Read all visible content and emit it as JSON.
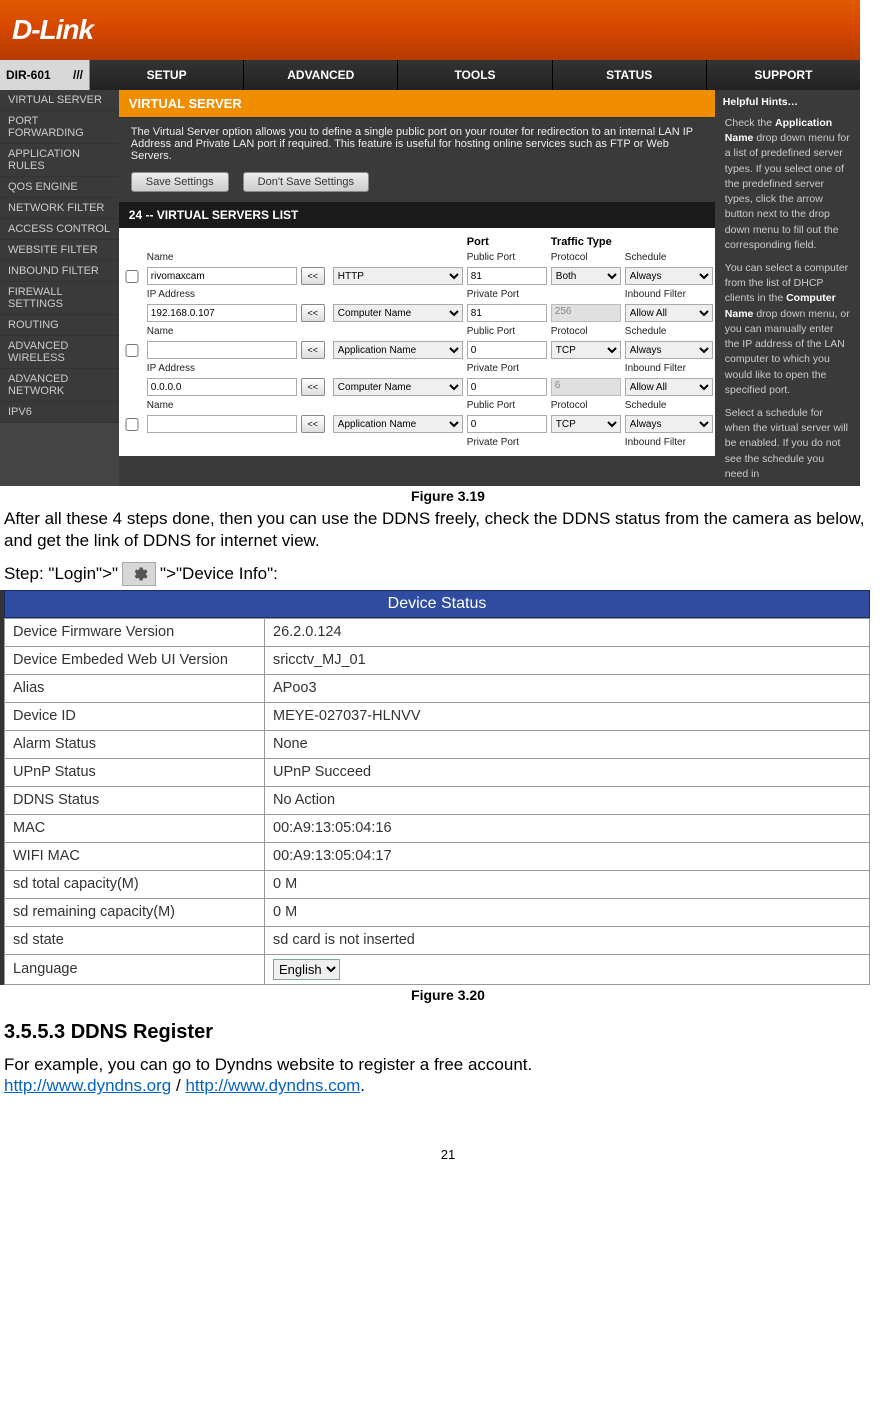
{
  "router": {
    "logo_text": "D-Link",
    "model": "DIR-601",
    "model_bars": "///",
    "tabs": [
      "SETUP",
      "ADVANCED",
      "TOOLS",
      "STATUS",
      "SUPPORT"
    ],
    "sidebar": [
      "VIRTUAL SERVER",
      "PORT FORWARDING",
      "APPLICATION RULES",
      "QOS ENGINE",
      "NETWORK FILTER",
      "ACCESS CONTROL",
      "WEBSITE FILTER",
      "INBOUND FILTER",
      "FIREWALL SETTINGS",
      "ROUTING",
      "ADVANCED WIRELESS",
      "ADVANCED NETWORK",
      "IPV6"
    ],
    "vs_title": "VIRTUAL SERVER",
    "vs_desc": "The Virtual Server option allows you to define a single public port on your router for redirection to an internal LAN IP Address and Private LAN port if required. This feature is useful for hosting online services such as FTP or Web Servers.",
    "btn_save": "Save Settings",
    "btn_dont": "Don't Save Settings",
    "vs_list_title": "24 -- VIRTUAL SERVERS LIST",
    "col_port": "Port",
    "col_traffic": "Traffic Type",
    "lbl_name": "Name",
    "lbl_ip": "IP Address",
    "lbl_public": "Public Port",
    "lbl_private": "Private Port",
    "lbl_protocol": "Protocol",
    "lbl_schedule": "Schedule",
    "lbl_inbound": "Inbound Filter",
    "entries": [
      {
        "name": "rivomaxcam",
        "app_sel": "HTTP",
        "ip": "192.168.0.107",
        "comp_sel": "Computer Name",
        "public_port": "81",
        "private_port": "81",
        "protocol": "Both",
        "schedule": "Always",
        "traffic_disabled": "256",
        "inbound": "Allow All"
      },
      {
        "name": "",
        "app_sel": "Application Name",
        "ip": "0.0.0.0",
        "comp_sel": "Computer Name",
        "public_port": "0",
        "private_port": "0",
        "protocol": "TCP",
        "schedule": "Always",
        "traffic_disabled": "6",
        "inbound": "Allow All"
      },
      {
        "name": "",
        "app_sel": "Application Name",
        "ip": "",
        "comp_sel": "",
        "public_port": "0",
        "private_port": "",
        "protocol": "TCP",
        "schedule": "Always",
        "traffic_disabled": "",
        "inbound": ""
      }
    ],
    "hints_title": "Helpful Hints…",
    "hints_p1a": "Check the ",
    "hints_p1b": "Application Name",
    "hints_p1c": " drop down menu for a list of predefined server types. If you select one of the predefined server types, click the arrow button next to the drop down menu to fill out the corresponding field.",
    "hints_p2a": "You can select a computer from the list of DHCP clients in the ",
    "hints_p2b": "Computer Name",
    "hints_p2c": " drop down menu, or you can manually enter the IP address of the LAN computer to which you would like to open the specified port.",
    "hints_p3": "Select a schedule for when the virtual server will be enabled. If you do not see the schedule you need in"
  },
  "fig1": "Figure 3.19",
  "para_after": "After all these 4 steps done, then you can use the DDNS freely, check the DDNS status from the camera as below, and get the link of DDNS for internet view.",
  "step_prefix": "Step: \"Login\">\"",
  "step_suffix": "\">\"Device Info\":",
  "device_status": {
    "title": "Device Status",
    "rows": [
      [
        "Device Firmware Version",
        "26.2.0.124"
      ],
      [
        "Device Embeded Web UI Version",
        "sricctv_MJ_01"
      ],
      [
        "Alias",
        "APoo3"
      ],
      [
        "Device ID",
        "MEYE-027037-HLNVV"
      ],
      [
        "Alarm Status",
        "None"
      ],
      [
        "UPnP Status",
        "UPnP Succeed"
      ],
      [
        "DDNS Status",
        "No Action"
      ],
      [
        "MAC",
        "00:A9:13:05:04:16"
      ],
      [
        "WIFI MAC",
        "00:A9:13:05:04:17"
      ],
      [
        "sd total capacity(M)",
        "0 M"
      ],
      [
        "sd remaining capacity(M)",
        "0 M"
      ],
      [
        "sd state",
        "sd card is not inserted"
      ]
    ],
    "lang_label": "Language",
    "lang_value": "English"
  },
  "fig2": "Figure 3.20",
  "section_heading": "3.5.5.3 DDNS Register",
  "reg_text": "For example, you can go to Dyndns website to register a free account. ",
  "reg_link1": "http://www.dyndns.org",
  "reg_sep": " / ",
  "reg_link2": "http://www.dyndns.com",
  "reg_after": ".",
  "page_number": "21"
}
